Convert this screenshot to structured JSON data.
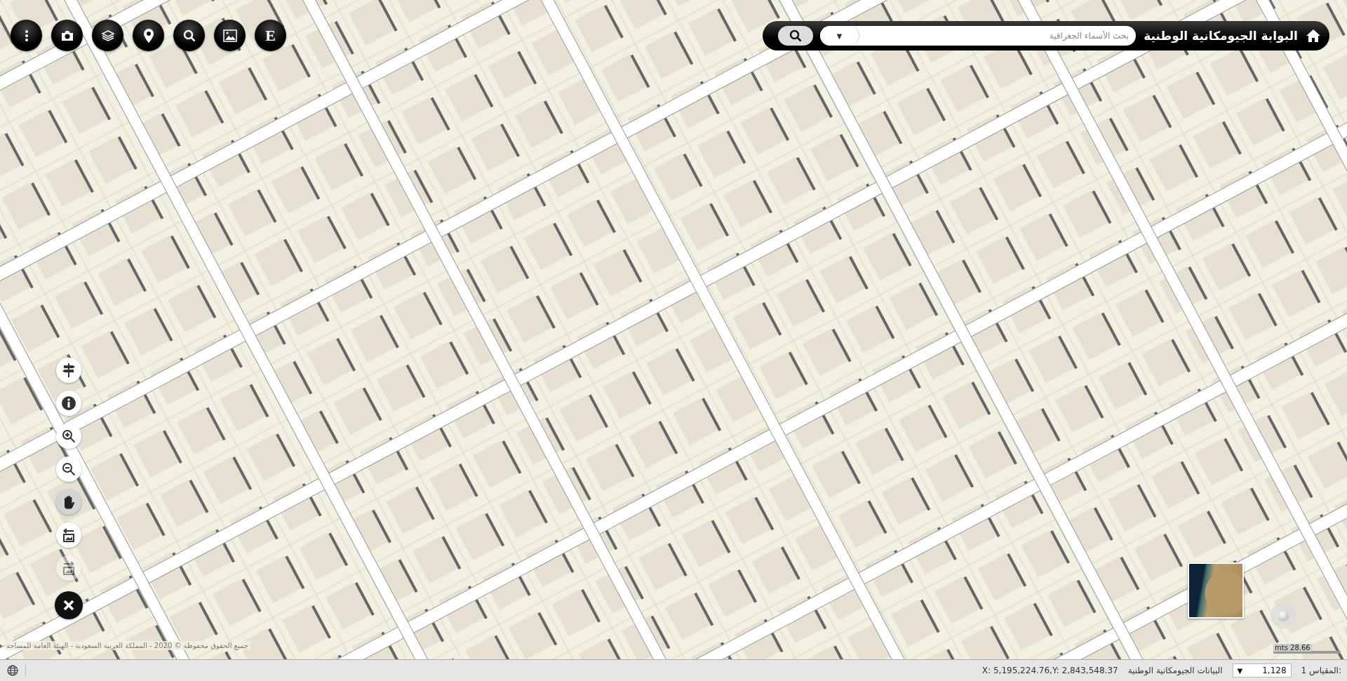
{
  "toolbar": [
    {
      "kind": "menu"
    },
    {
      "kind": "camera"
    },
    {
      "kind": "layers"
    },
    {
      "kind": "pin"
    },
    {
      "kind": "search"
    },
    {
      "kind": "image"
    },
    {
      "kind": "letter",
      "label": "E"
    }
  ],
  "header": {
    "title": "البوابة الجيومكانية الوطنية",
    "search": {
      "placeholder": "بحث الأسماء الجغرافية"
    },
    "dropdown_arrow": "▼"
  },
  "map_tools": [
    {
      "kind": "directions",
      "selected": false,
      "disabled": false
    },
    {
      "kind": "info",
      "selected": false,
      "disabled": false
    },
    {
      "kind": "zoom-in",
      "selected": false,
      "disabled": false
    },
    {
      "kind": "zoom-out",
      "selected": false,
      "disabled": false
    },
    {
      "kind": "pan",
      "selected": true,
      "disabled": false
    },
    {
      "kind": "previous-extent",
      "selected": false,
      "disabled": false
    },
    {
      "kind": "next-extent",
      "selected": false,
      "disabled": true
    },
    {
      "kind": "close",
      "selected": false,
      "disabled": false
    }
  ],
  "copyright": "جميع الحقوق محفوظة © 2020 - المملكة العربية السعودية - الهيئة العامة للمساحة",
  "scale_bar": {
    "label": "mts 28.66"
  },
  "status_bar": {
    "scale_label": "المقياس 1:",
    "scale_value": "1,128",
    "scale_arrow": "▼",
    "source": "البيانات الجيومكانية الوطنية",
    "coordinates": "X: 5,195,224.76,Y: 2,843,548.37"
  }
}
